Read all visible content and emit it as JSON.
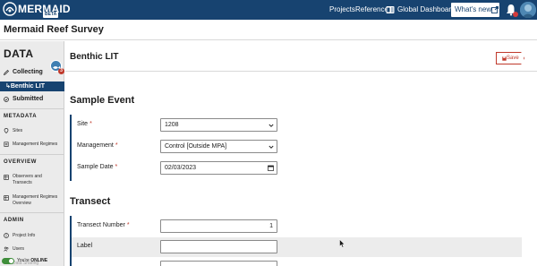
{
  "app": {
    "logo_text": "MERMAID",
    "logo_badge": "BETA"
  },
  "nav": {
    "projects": "Projects",
    "reference": "Reference",
    "global_dashboard": "Global Dashboard",
    "whats_new": "What's new"
  },
  "project": {
    "title": "Mermaid Reef Survey"
  },
  "sidebar": {
    "data_heading": "DATA",
    "collecting": "Collecting",
    "collecting_count": "3",
    "active_item": "Benthic LIT",
    "submitted": "Submitted",
    "metadata_heading": "METADATA",
    "sites": "Sites",
    "management_regimes": "Management Regimes",
    "overview_heading": "OVERVIEW",
    "observers_line1": "Observers and",
    "observers_line2": "Transects",
    "mr_overview_line1": "Management Regimes",
    "mr_overview_line2": "Overview",
    "admin_heading": "ADMIN",
    "project_info": "Project Info",
    "users": "Users",
    "status_prefix": "You're",
    "status_value": "ONLINE",
    "status_cut": "Data Sharing"
  },
  "page": {
    "title": "Benthic LIT",
    "save_label": "Save"
  },
  "sample_event": {
    "title": "Sample Event",
    "site_label": "Site",
    "site_value": "1208",
    "management_label": "Management",
    "management_value": "Control [Outside MPA]",
    "date_label": "Sample Date",
    "date_value": "02/03/2023",
    "required_mark": "*"
  },
  "transect": {
    "title": "Transect",
    "number_label": "Transect Number",
    "number_value": "1",
    "label_label": "Label",
    "label_value": ""
  },
  "colors": {
    "brand": "#174370",
    "accent_red": "#c0392b",
    "online": "#3f8e3b"
  }
}
